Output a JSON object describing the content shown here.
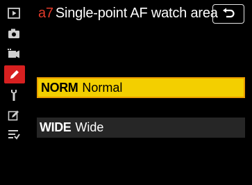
{
  "menu": {
    "code": "a7",
    "title": "Single-point AF watch area"
  },
  "sidebar": {
    "items": [
      {
        "icon": "playback-icon"
      },
      {
        "icon": "photo-shooting-icon"
      },
      {
        "icon": "video-recording-icon"
      },
      {
        "icon": "custom-settings-pencil-icon",
        "active": true
      },
      {
        "icon": "setup-wrench-icon"
      },
      {
        "icon": "retouch-icon"
      },
      {
        "icon": "my-menu-icon"
      }
    ]
  },
  "options": [
    {
      "abbr": "NORM",
      "label": "Normal",
      "selected": true
    },
    {
      "abbr": "WIDE",
      "label": "Wide",
      "selected": false
    }
  ],
  "colors": {
    "selected_bg": "#f3cf00",
    "selected_border": "#e99c00",
    "unselected_bg": "#262626",
    "active_tab": "#d72020",
    "menu_code": "#e23a2a"
  }
}
